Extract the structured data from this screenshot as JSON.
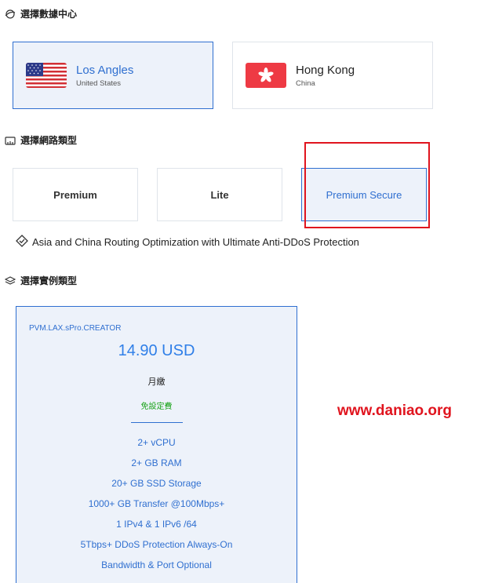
{
  "datacenter": {
    "title": "選擇數據中心",
    "options": [
      {
        "name": "Los Angles",
        "country": "United States"
      },
      {
        "name": "Hong Kong",
        "country": "China"
      }
    ]
  },
  "network": {
    "title": "選擇網路類型",
    "options": [
      {
        "label": "Premium"
      },
      {
        "label": "Lite"
      },
      {
        "label": "Premium Secure"
      }
    ],
    "description": "Asia and China Routing Optimization with Ultimate Anti-DDoS Protection"
  },
  "instance": {
    "title": "選擇實例類型",
    "plan": {
      "code": "PVM.LAX.sPro.CREATOR",
      "price": "14.90 USD",
      "period": "月繳",
      "setup_fee": "免設定費",
      "features": [
        "2+ vCPU",
        "2+ GB RAM",
        "20+ GB SSD Storage",
        "1000+ GB Transfer @100Mbps+",
        "1 IPv4 & 1 IPv6 /64",
        "5Tbps+ DDoS Protection Always-On",
        "Bandwidth & Port Optional"
      ]
    }
  },
  "watermark": "www.daniao.org",
  "colors": {
    "accent": "#2f6fd0",
    "price": "#2f7fe8",
    "setup_fee": "#1aa31a",
    "highlight": "#e0141e",
    "selected_bg": "#edf2fa"
  }
}
